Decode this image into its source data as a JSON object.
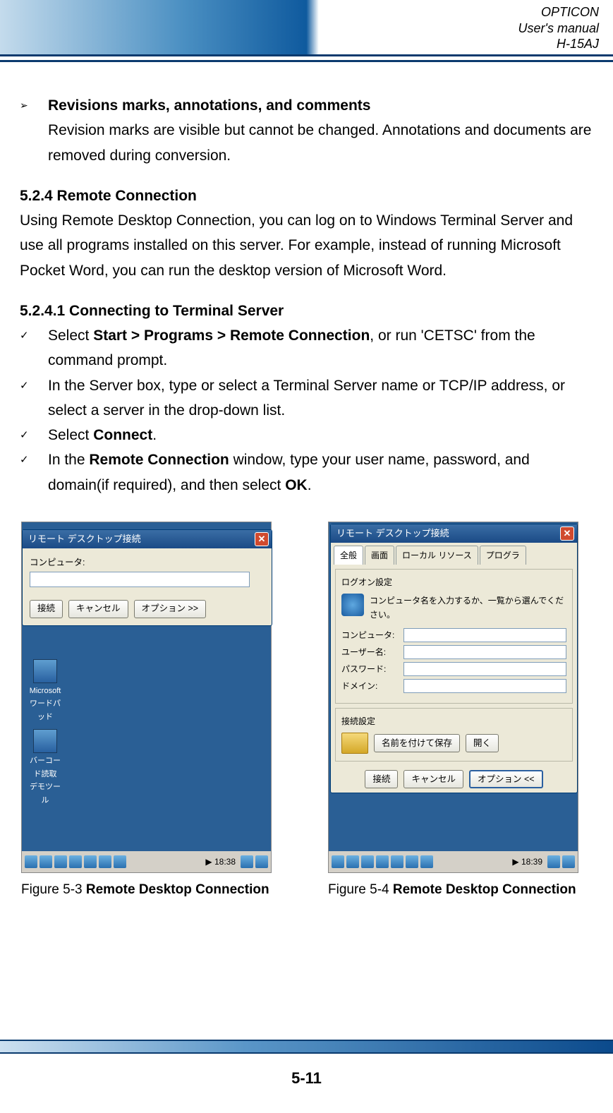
{
  "header": {
    "brand": "OPTICON",
    "doc": "User's manual",
    "model": "H-15AJ"
  },
  "section_bullet": {
    "title": "Revisions marks, annotations, and comments",
    "body": "Revision marks are visible but cannot be changed. Annotations and documents are removed during conversion."
  },
  "h524": {
    "title": "5.2.4 Remote Connection",
    "body": "Using Remote Desktop Connection, you can log on to Windows Terminal Server and use all programs installed on this server. For example, instead of running Microsoft Pocket Word, you can run the desktop version of Microsoft Word."
  },
  "h5241": {
    "title": "5.2.4.1 Connecting to Terminal Server",
    "steps": [
      {
        "pre": "Select ",
        "bold": "Start > Programs > Remote Connection",
        "post": ", or run 'CETSC' from the command prompt."
      },
      {
        "pre": "In the Server box, type or select a Terminal Server name or TCP/IP address, or select a server in the drop-down list.",
        "bold": "",
        "post": ""
      },
      {
        "pre": "Select ",
        "bold": "Connect",
        "post": "."
      },
      {
        "pre": "In the ",
        "bold": "Remote Connection",
        "mid": " window, type your user name, password, and domain(if required), and then select ",
        "bold2": "OK",
        "post": "."
      }
    ]
  },
  "figures": {
    "a": {
      "num": "Figure 5-3 ",
      "title": "Remote Desktop Connection"
    },
    "b": {
      "num": "Figure 5-4 ",
      "title": "Remote Desktop Connection"
    }
  },
  "mockA": {
    "titlebar": "リモート デスクトップ接続",
    "computer_label": "コンピュータ:",
    "btn_connect": "接続",
    "btn_cancel": "キャンセル",
    "btn_options": "オプション >>",
    "desk_icon1": "Microsoft\nワードパッド",
    "desk_icon2": "バーコード読取\nデモツール",
    "time": "18:38"
  },
  "mockB": {
    "titlebar": "リモート デスクトップ接続",
    "tabs": [
      "全般",
      "画面",
      "ローカル リソース",
      "プログラ"
    ],
    "group1_title": "ログオン設定",
    "info_text": "コンピュータ名を入力するか、一覧から選んでください。",
    "field_computer": "コンピュータ:",
    "field_user": "ユーザー名:",
    "field_pass": "パスワード:",
    "field_domain": "ドメイン:",
    "group2_title": "接続設定",
    "btn_saveas": "名前を付けて保存",
    "btn_open": "開く",
    "btn_connect": "接続",
    "btn_cancel": "キャンセル",
    "btn_options": "オプション <<",
    "time": "18:39"
  },
  "page_number": "5-11"
}
